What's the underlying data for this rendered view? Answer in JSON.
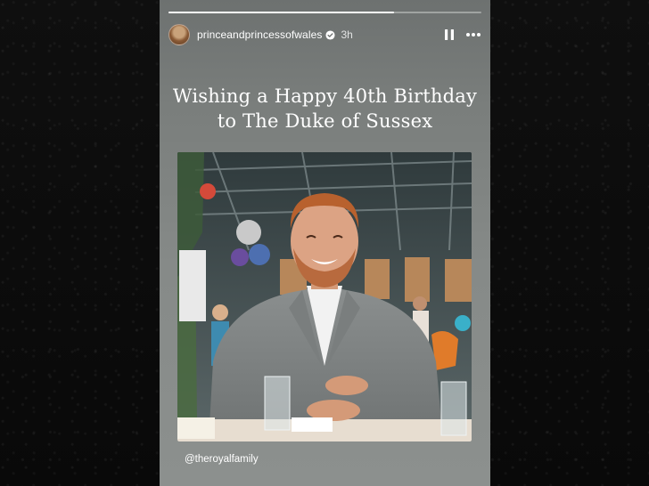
{
  "story": {
    "username": "princeandprincessofwales",
    "time_ago": "3h",
    "progress": 0.72,
    "headline_line1": "Wishing a Happy 40th Birthday",
    "headline_line2": "to The Duke of Sussex",
    "mention": "@theroyalfamily"
  },
  "icons": {
    "verified": "verified-badge-icon",
    "pause": "pause-icon",
    "more": "more-options-icon"
  },
  "colors": {
    "story_bg_top": "#6d7170",
    "story_bg_bottom": "#8c908e",
    "backdrop": "#0b0b0b",
    "verified_badge": "#3897f0"
  }
}
